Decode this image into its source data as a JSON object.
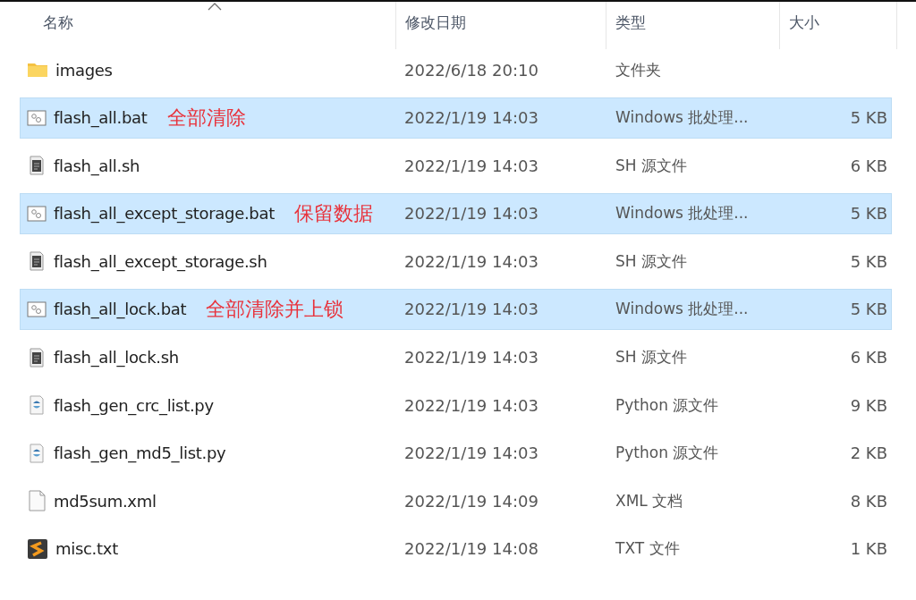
{
  "columns": [
    {
      "label": "名称",
      "sorted": true
    },
    {
      "label": "修改日期",
      "sorted": false
    },
    {
      "label": "类型",
      "sorted": false
    },
    {
      "label": "大小",
      "sorted": false
    }
  ],
  "files": [
    {
      "kind": "folder",
      "name": "images",
      "date": "2022/6/18 20:10",
      "type": "文件夹",
      "selected": false
    },
    {
      "kind": "bat",
      "name": "flash_all.bat",
      "note": "全部清除",
      "date": "2022/1/19 14:03",
      "type": "Windows 批处理...",
      "size": "5 KB",
      "selected": true
    },
    {
      "kind": "sh",
      "name": "flash_all.sh",
      "date": "2022/1/19 14:03",
      "type": "SH 源文件",
      "size": "6 KB",
      "selected": false
    },
    {
      "kind": "bat",
      "name": "flash_all_except_storage.bat",
      "note": "保留数据",
      "date": "2022/1/19 14:03",
      "type": "Windows 批处理...",
      "size": "5 KB",
      "selected": true
    },
    {
      "kind": "sh",
      "name": "flash_all_except_storage.sh",
      "date": "2022/1/19 14:03",
      "type": "SH 源文件",
      "size": "5 KB",
      "selected": false
    },
    {
      "kind": "bat",
      "name": "flash_all_lock.bat",
      "note": "全部清除并上锁",
      "date": "2022/1/19 14:03",
      "type": "Windows 批处理...",
      "size": "5 KB",
      "selected": true
    },
    {
      "kind": "sh",
      "name": "flash_all_lock.sh",
      "date": "2022/1/19 14:03",
      "type": "SH 源文件",
      "size": "6 KB",
      "selected": false
    },
    {
      "kind": "py",
      "name": "flash_gen_crc_list.py",
      "date": "2022/1/19 14:03",
      "type": "Python 源文件",
      "size": "9 KB",
      "selected": false
    },
    {
      "kind": "py",
      "name": "flash_gen_md5_list.py",
      "date": "2022/1/19 14:03",
      "type": "Python 源文件",
      "size": "2 KB",
      "selected": false
    },
    {
      "kind": "xml",
      "name": "md5sum.xml",
      "date": "2022/1/19 14:09",
      "type": "XML 文档",
      "size": "8 KB",
      "selected": false
    },
    {
      "kind": "txt",
      "name": "misc.txt",
      "date": "2022/1/19 14:08",
      "type": "TXT 文件",
      "size": "1 KB",
      "selected": false
    }
  ]
}
